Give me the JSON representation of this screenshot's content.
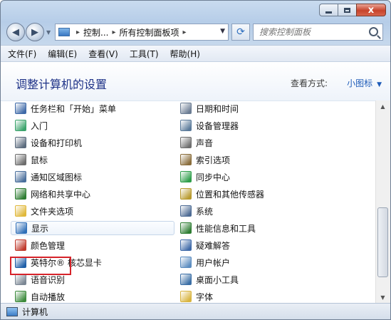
{
  "window": {
    "min_label": "",
    "max_label": "",
    "close_label": "x"
  },
  "nav": {
    "back_glyph": "◀",
    "forward_glyph": "▶",
    "dropdown_glyph": "▼"
  },
  "address": {
    "crumbs": [
      "控制...",
      "所有控制面板项"
    ],
    "separator": "▸",
    "dropdown_glyph": "▼"
  },
  "refresh_glyph": "⟳",
  "search": {
    "placeholder": "搜索控制面板"
  },
  "menu": [
    "文件(F)",
    "编辑(E)",
    "查看(V)",
    "工具(T)",
    "帮助(H)"
  ],
  "header": {
    "title": "调整计算机的设置",
    "view_by_label": "查看方式:",
    "view_by_value": "小图标"
  },
  "items_left": [
    {
      "label": "任务栏和「开始」菜单",
      "icon": "taskbar-icon",
      "color": "#3f6aa8"
    },
    {
      "label": "入门",
      "icon": "getting-started-icon",
      "color": "#3aa36b"
    },
    {
      "label": "设备和打印机",
      "icon": "printer-icon",
      "color": "#5b6b7d"
    },
    {
      "label": "鼠标",
      "icon": "mouse-icon",
      "color": "#6d6d6d"
    },
    {
      "label": "通知区域图标",
      "icon": "notification-icon",
      "color": "#4a6f9c"
    },
    {
      "label": "网络和共享中心",
      "icon": "network-icon",
      "color": "#2e7d32"
    },
    {
      "label": "文件夹选项",
      "icon": "folder-icon",
      "color": "#e0b83a"
    },
    {
      "label": "显示",
      "icon": "display-icon",
      "color": "#2f6fb8"
    },
    {
      "label": "颜色管理",
      "icon": "color-management-icon",
      "color": "#c0392b"
    },
    {
      "label": "英特尔® 核芯显卡",
      "icon": "intel-graphics-icon",
      "color": "#1f5fa8"
    },
    {
      "label": "语音识别",
      "icon": "microphone-icon",
      "color": "#7b8794"
    },
    {
      "label": "自动播放",
      "icon": "autoplay-icon",
      "color": "#3d8b3d"
    }
  ],
  "items_right": [
    {
      "label": "日期和时间",
      "icon": "clock-icon",
      "color": "#6b7c93"
    },
    {
      "label": "设备管理器",
      "icon": "device-manager-icon",
      "color": "#5a7a9a"
    },
    {
      "label": "声音",
      "icon": "speaker-icon",
      "color": "#6e6e6e"
    },
    {
      "label": "索引选项",
      "icon": "index-icon",
      "color": "#8a6d3b"
    },
    {
      "label": "同步中心",
      "icon": "sync-icon",
      "color": "#2e9e4a"
    },
    {
      "label": "位置和其他传感器",
      "icon": "sensor-icon",
      "color": "#b89a2e"
    },
    {
      "label": "系统",
      "icon": "system-icon",
      "color": "#4d6b94"
    },
    {
      "label": "性能信息和工具",
      "icon": "performance-icon",
      "color": "#2e7d32"
    },
    {
      "label": "疑难解答",
      "icon": "troubleshoot-icon",
      "color": "#3f6aa8"
    },
    {
      "label": "用户帐户",
      "icon": "user-accounts-icon",
      "color": "#5b8cc0"
    },
    {
      "label": "桌面小工具",
      "icon": "gadgets-icon",
      "color": "#3a6ea5"
    },
    {
      "label": "字体",
      "icon": "fonts-icon",
      "color": "#d8b440"
    }
  ],
  "status": {
    "text": "计算机"
  },
  "scroll": {
    "up_glyph": "▲",
    "down_glyph": "▼"
  }
}
